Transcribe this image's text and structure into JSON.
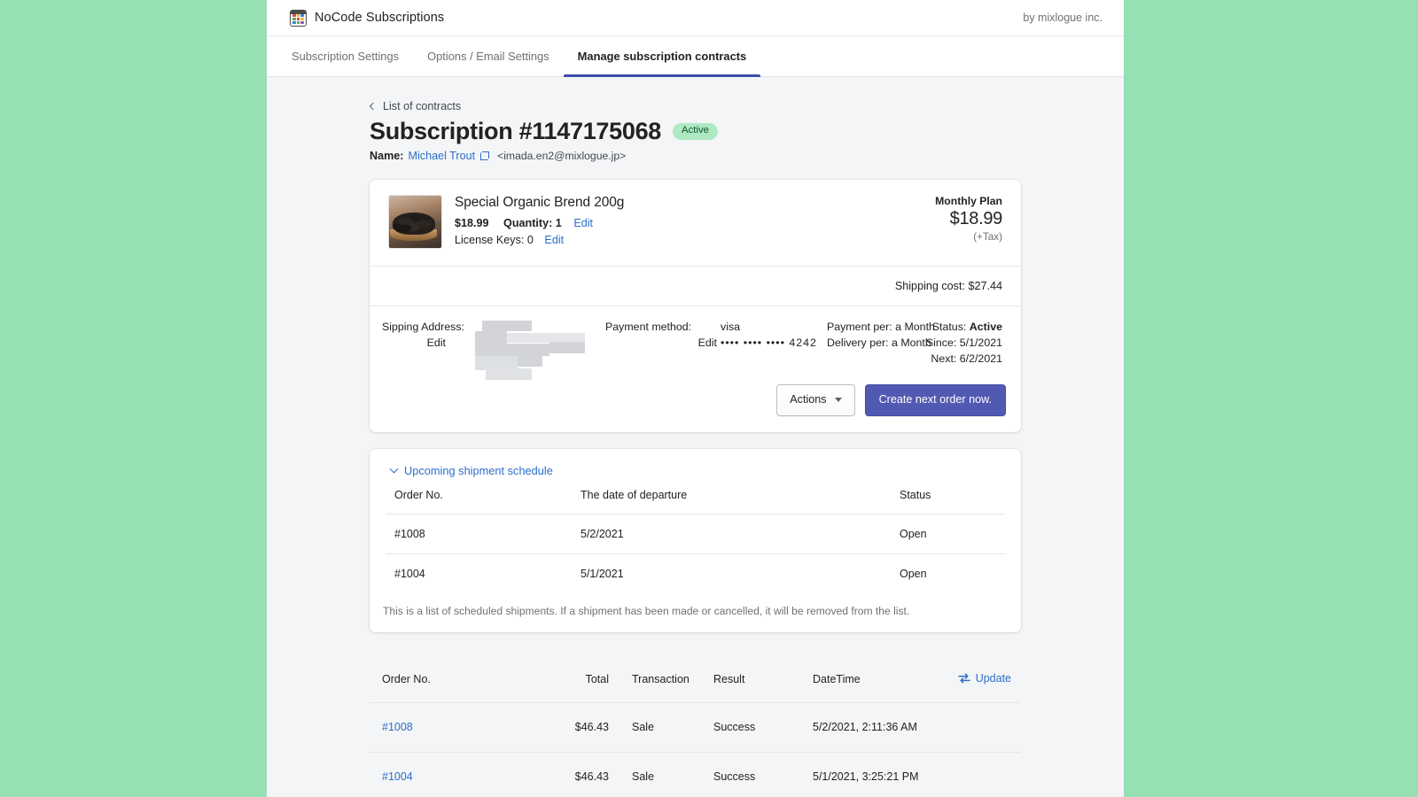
{
  "theme": {
    "page_bg": "#96e0b4",
    "app_bg": "#f4f5f7",
    "accent_blue": "#2c6ecb",
    "primary_button": "#5159b3",
    "tab_underline": "#3d4eac",
    "badge_bg": "#aee9c3"
  },
  "topbar": {
    "app_icon": "calendar-icon",
    "title": "NoCode Subscriptions",
    "byline": "by mixlogue inc."
  },
  "tabs": [
    {
      "label": "Subscription Settings",
      "active": false
    },
    {
      "label": "Options / Email Settings",
      "active": false
    },
    {
      "label": "Manage subscription contracts",
      "active": true
    }
  ],
  "breadcrumb": {
    "icon": "chevron-left-icon",
    "label": "List of contracts"
  },
  "header": {
    "title": "Subscription #1147175068",
    "status_badge": "Active",
    "name_label": "Name:",
    "customer_name": "Michael Trout",
    "external_link_icon": "external-link-icon",
    "customer_email": "<imada.en2@mixlogue.jp>"
  },
  "product": {
    "thumbnail": "coffee-beans-photo",
    "name": "Special Organic Brend 200g",
    "price": "$18.99",
    "quantity_label": "Quantity: 1",
    "quantity_edit": "Edit",
    "license_keys_label": "License Keys: 0",
    "license_keys_edit": "Edit",
    "plan_label": "Monthly Plan",
    "plan_price": "$18.99",
    "plan_tax_note": "(+Tax)"
  },
  "shipping_cost_line": "Shipping cost: $27.44",
  "details": {
    "shipping_address_label": "Sipping Address:",
    "shipping_address_edit": "Edit",
    "shipping_address_value": "",
    "payment_method_label": "Payment method:",
    "payment_method_edit": "Edit",
    "payment_method_brand": "visa",
    "payment_card_mask": "•••• •••• •••• 4242",
    "payment_per": "Payment per: a Month",
    "delivery_per": "Delivery per: a Month",
    "status_label": "Status:",
    "status_value": "Active",
    "since_line": "Since: 5/1/2021",
    "next_line": "Next: 6/2/2021"
  },
  "actions": {
    "actions_label": "Actions",
    "actions_caret": "caret-down-icon",
    "create_order_label": "Create next order now."
  },
  "schedule": {
    "toggle_icon": "chevron-down-icon",
    "toggle_label": "Upcoming shipment schedule",
    "columns": [
      "Order No.",
      "The date of departure",
      "Status"
    ],
    "rows": [
      {
        "order_no": "#1008",
        "date": "5/2/2021",
        "status": "Open"
      },
      {
        "order_no": "#1004",
        "date": "5/1/2021",
        "status": "Open"
      }
    ],
    "note": "This is a list of scheduled shipments. If a shipment has been made or cancelled, it will be removed from the list."
  },
  "transactions": {
    "columns": [
      "Order No.",
      "Total",
      "Transaction",
      "Result",
      "DateTime"
    ],
    "update_icon": "swap-arrows-icon",
    "update_label": "Update",
    "rows": [
      {
        "order_no": "#1008",
        "total": "$46.43",
        "transaction": "Sale",
        "result": "Success",
        "datetime": "5/2/2021, 2:11:36 AM"
      },
      {
        "order_no": "#1004",
        "total": "$46.43",
        "transaction": "Sale",
        "result": "Success",
        "datetime": "5/1/2021, 3:25:21 PM"
      }
    ]
  }
}
